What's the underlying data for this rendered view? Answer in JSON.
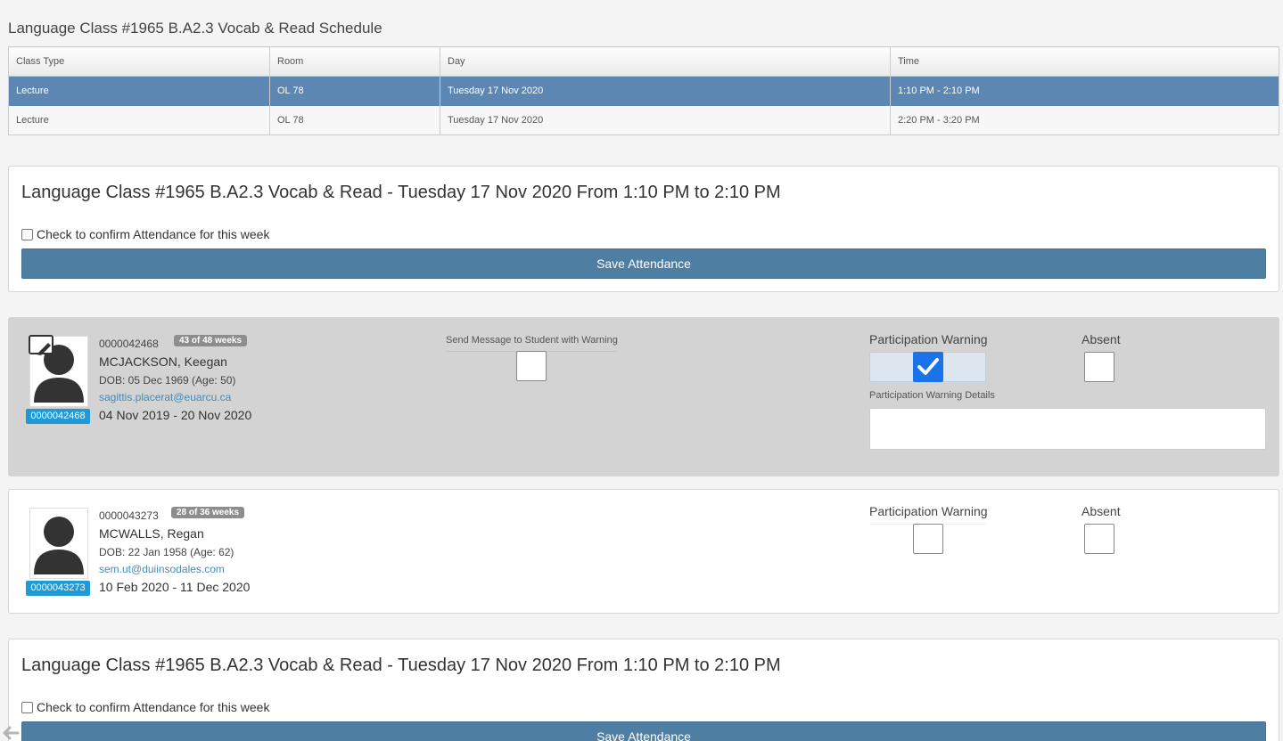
{
  "schedule": {
    "title": "Language Class #1965 B.A2.3 Vocab & Read Schedule",
    "headers": [
      "Class Type",
      "Room",
      "Day",
      "Time"
    ],
    "rows": [
      {
        "type": "Lecture",
        "room": "OL 78",
        "day": "Tuesday 17 Nov 2020",
        "time": "1:10 PM - 2:10 PM"
      },
      {
        "type": "Lecture",
        "room": "OL 78",
        "day": "Tuesday 17 Nov 2020",
        "time": "2:20 PM - 3:20 PM"
      }
    ]
  },
  "session_panel": {
    "title": "Language Class #1965 B.A2.3 Vocab & Read - Tuesday 17 Nov 2020 From 1:10 PM to 2:10 PM",
    "confirm_label": "Check to confirm Attendance for this week",
    "save_label": "Save Attendance"
  },
  "labels": {
    "send_message": "Send Message to Student with Warning",
    "participation_warning": "Participation Warning",
    "absent": "Absent",
    "warning_details": "Participation Warning Details"
  },
  "students": [
    {
      "id": "0000042468",
      "weeks": "43 of 48 weeks",
      "name": "MCJACKSON, Keegan",
      "dob": "DOB: 05 Dec 1969 (Age: 50)",
      "email": "sagittis.placerat@euarcu.ca",
      "dates": "04 Nov 2019 - 20 Nov 2020",
      "participation_warning": true,
      "absent": false
    },
    {
      "id": "0000043273",
      "weeks": "28 of 36 weeks",
      "name": "MCWALLS, Regan",
      "dob": "DOB: 22 Jan 1958 (Age: 62)",
      "email": "sem.ut@duiinsodales.com",
      "dates": "10 Feb 2020 - 11 Dec 2020",
      "participation_warning": false,
      "absent": false
    }
  ]
}
